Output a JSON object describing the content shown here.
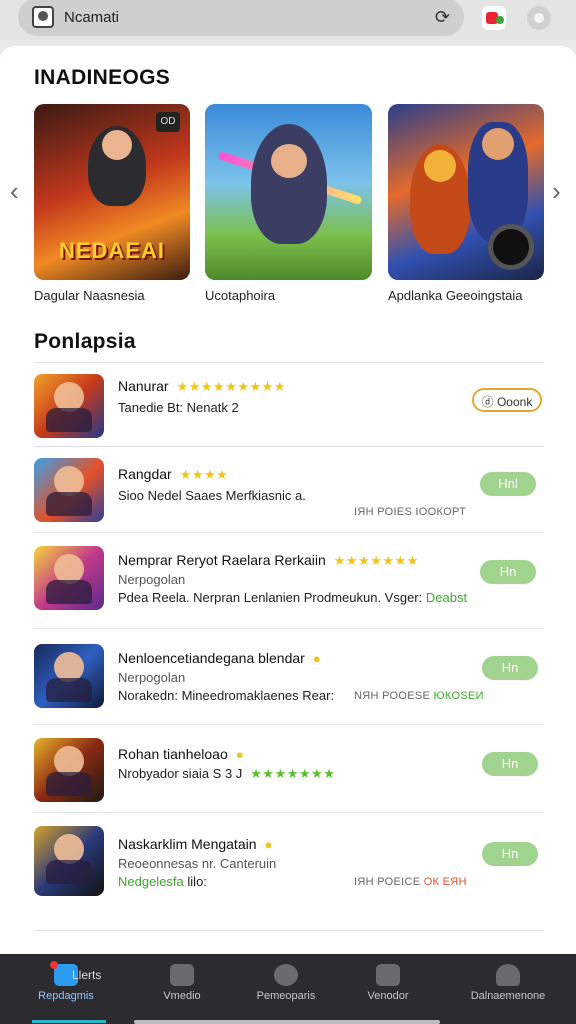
{
  "search": {
    "query": "Ncamati"
  },
  "featured": {
    "title": "INADINEOGS",
    "items": [
      {
        "label": "Dagular Naasnesia",
        "art_text": "NEDAEAI",
        "tag": "OD"
      },
      {
        "label": "Ucotaphoira"
      },
      {
        "label": "Apdlanka Geeoingstaia"
      }
    ]
  },
  "popular": {
    "title": "Ponlapsia",
    "items": [
      {
        "name": "Nanurar",
        "stars": "★★★★★★★★★",
        "sub": "Tanedie Bt: Nenatk 2",
        "button": "ⓓ Ooonk"
      },
      {
        "name": "Rangdar",
        "stars": "★★★★",
        "sub": "Sioo Nedel Saaes Merfkiasnic a.",
        "meta": "ІЯН РОІЕЅ ІООКОРТ",
        "button": "Hnl"
      },
      {
        "name": "Nemprar Reryot Raelara Rerkaiin",
        "stars": "★★★★★★★",
        "sub1": "Nerpogolan",
        "sub2": "Pdea Reela. Nerpran Lenlanien Prodmeukun. Vsger:",
        "sub2_hl": "Deabst",
        "button": "Hn"
      },
      {
        "name": "Nenloencetiandegana blendar",
        "sub1": "Nerpogolan",
        "sub2": "Norakedn: Mineedromaklaenes Rear:",
        "meta": "NЯН РООЕЅЕ",
        "meta_hl": "ЮКОЅЕИ",
        "button": "Hn"
      },
      {
        "name": "Rohan tianheloao",
        "sub1": "Nrobyador siaia S 3 J",
        "stars": "★★★★★★★",
        "button": "Hn"
      },
      {
        "name": "Naskarklim Mengatain",
        "sub1": "Reoeonnesas nr. Canteruin",
        "sub2": "Nedgelesfa",
        "sub2_rest": "lilo:",
        "meta": "ІЯН РОЕІСЕ",
        "meta_hl": "ОК ЕЯН",
        "button": "Hn"
      }
    ]
  },
  "nav": [
    {
      "label": "Repdagmis",
      "top": "Llerts"
    },
    {
      "label": "Vmedio"
    },
    {
      "label": "Pemeoparis"
    },
    {
      "label": "Venodor"
    },
    {
      "label": "Dalnaemenone"
    }
  ],
  "colors": {
    "accent": "#2c9bf0",
    "get_button": "#9fd38e",
    "outline_button": "#e7a533",
    "star": "#f3c21a",
    "navbar": "#2c2c30"
  }
}
